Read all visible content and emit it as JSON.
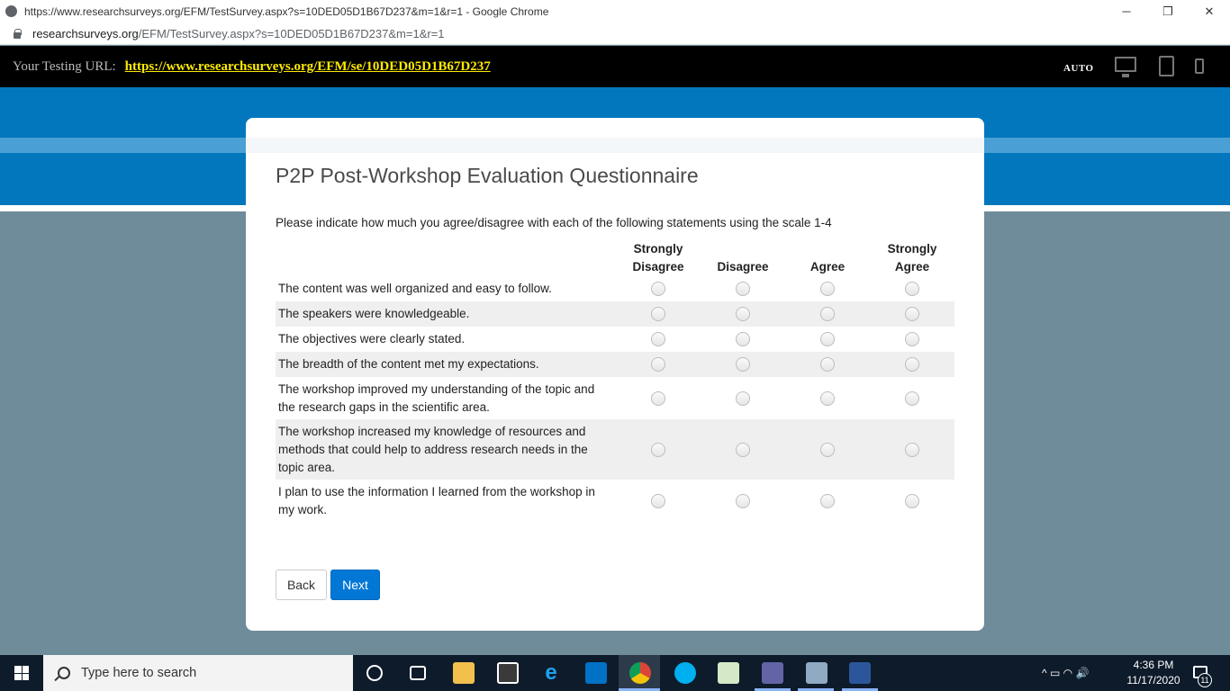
{
  "browser": {
    "window_title": "https://www.researchsurveys.org/EFM/TestSurvey.aspx?s=10DED05D1B67D237&m=1&r=1 - Google Chrome",
    "address_domain": "researchsurveys.org",
    "address_path": "/EFM/TestSurvey.aspx?s=10DED05D1B67D237&m=1&r=1",
    "minimize_glyph": "─",
    "restore_glyph": "❐",
    "close_glyph": "✕"
  },
  "testing_bar": {
    "label": "Your Testing URL:",
    "url": "https://www.researchsurveys.org/EFM/se/10DED05D1B67D237",
    "auto_label": "AUTO",
    "devices": [
      "desktop-icon",
      "tablet-icon",
      "phone-icon"
    ]
  },
  "survey": {
    "title": "P2P Post-Workshop Evaluation Questionnaire",
    "instruction": "Please indicate how much you agree/disagree with each of the following statements using the scale 1-4",
    "columns": [
      {
        "line1": "Strongly",
        "line2": "Disagree"
      },
      {
        "line1": "",
        "line2": "Disagree"
      },
      {
        "line1": "",
        "line2": "Agree"
      },
      {
        "line1": "Strongly",
        "line2": "Agree"
      }
    ],
    "statements": [
      "The content was well organized and easy to follow.",
      "The speakers were knowledgeable.",
      "The objectives were clearly stated.",
      "The breadth of the content met my expectations.",
      "The workshop improved my understanding of the topic and the research gaps in the scientific area.",
      "The workshop increased my knowledge of resources and methods that could help to address research needs in the topic area.",
      "I plan to use the information I learned from the workshop in my work."
    ],
    "back_label": "Back",
    "next_label": "Next"
  },
  "taskbar": {
    "search_placeholder": "Type here to search",
    "time": "4:36 PM",
    "date": "11/17/2020",
    "notification_count": "11",
    "tray_glyphs": "^  ▭  ◠  🔊"
  },
  "colors": {
    "brand_blue": "#0277bd",
    "next_button": "#0277d6",
    "test_url": "#ffea00"
  }
}
